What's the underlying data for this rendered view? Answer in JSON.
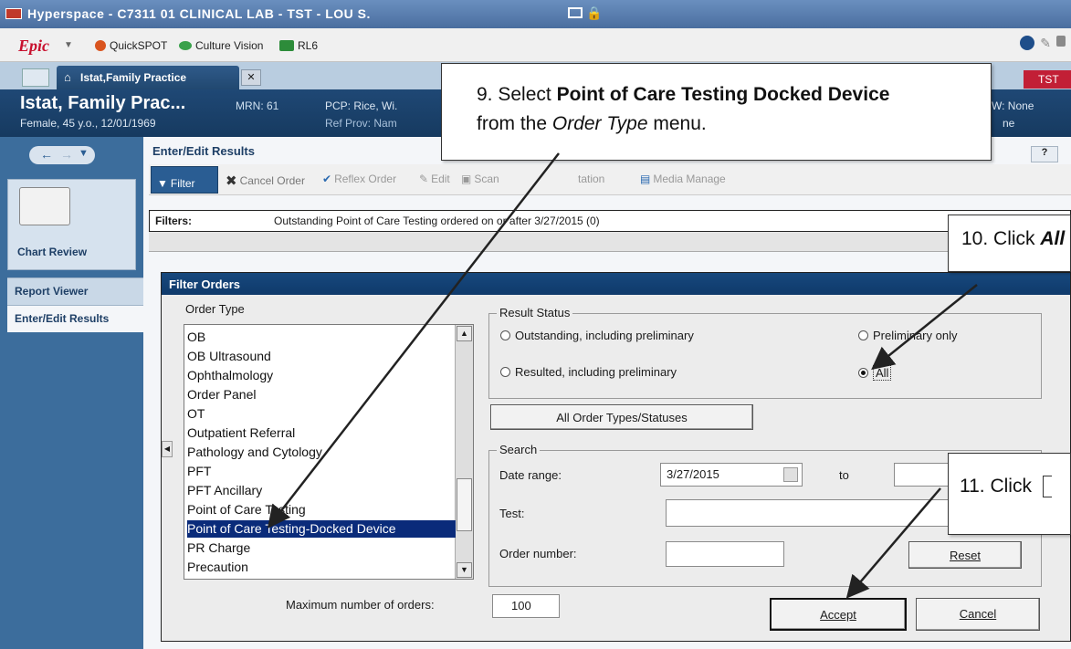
{
  "window": {
    "title": "Hyperspace - C7311 01 CLINICAL LAB - TST - LOU S."
  },
  "toolbar": {
    "epic_label": "Epic",
    "items": [
      "QuickSPOT",
      "Culture Vision",
      "RL6"
    ]
  },
  "tabs": {
    "patient_tab": "Istat,Family Practice",
    "tst_badge": "TST"
  },
  "patient": {
    "name": "Istat, Family Prac...",
    "demographics": "Female, 45 y.o., 12/01/1969",
    "mrn": "MRN: 61",
    "pcp": "PCP: Rice, Wi.",
    "ref_prov": "Ref Prov: Nam",
    "allergies": "W: None",
    "extra": "ne"
  },
  "nav": {
    "chart_review": "Chart Review",
    "report_viewer": "Report Viewer",
    "enter_edit_results": "Enter/Edit Results"
  },
  "activity": {
    "title": "Enter/Edit Results",
    "help": "?",
    "toolbar": {
      "filter": "Filter",
      "cancel_order": "Cancel Order",
      "reflex_order": "Reflex Order",
      "edit": "Edit",
      "scan": "Scan",
      "station": "tation",
      "media_manager": "Media Manage"
    },
    "filters_label": "Filters:",
    "filters_text": "Outstanding Point of Care Testing ordered on or after 3/27/2015 (0)"
  },
  "dialog": {
    "title": "Filter Orders",
    "order_type_label": "Order Type",
    "order_types": [
      "OB",
      "OB Ultrasound",
      "Ophthalmology",
      "Order Panel",
      "OT",
      "Outpatient Referral",
      "Pathology and Cytology",
      "PFT",
      "PFT Ancillary",
      "Point of Care Testing",
      "Point of Care Testing-Docked Device",
      "PR Charge",
      "Precaution"
    ],
    "selected_order_type": "Point of Care Testing-Docked Device",
    "result_status": {
      "label": "Result Status",
      "options": [
        "Outstanding, including preliminary",
        "Preliminary only",
        "Resulted, including preliminary",
        "All"
      ],
      "selected": "All"
    },
    "all_types_button": "All Order Types/Statuses",
    "search": {
      "label": "Search",
      "date_range_label": "Date range:",
      "date_from": "3/27/2015",
      "to_label": "to",
      "date_to": "",
      "test_label": "Test:",
      "test_value": "",
      "order_number_label": "Order number:",
      "order_number_value": ""
    },
    "reset_button": "Reset",
    "max_orders_label": "Maximum number of orders:",
    "max_orders_value": "100",
    "accept_button": "Accept",
    "cancel_button": "Cancel"
  },
  "callouts": {
    "step9_line1_a": "9. Select ",
    "step9_line1_b": "Point of Care Testing Docked Device",
    "step9_line2_a": "from the ",
    "step9_line2_b": "Order Type",
    "step9_line2_c": " menu.",
    "step10_a": "10. Click ",
    "step10_b": "All",
    "step11": "11. Click"
  },
  "colors": {
    "title_bar": "#5a7fb0",
    "patient_header": "#1f4875",
    "nav_panel": "#3c6d9c",
    "dialog_title": "#17487d",
    "selection": "#0a2b7a",
    "tst_badge": "#c21f36"
  }
}
